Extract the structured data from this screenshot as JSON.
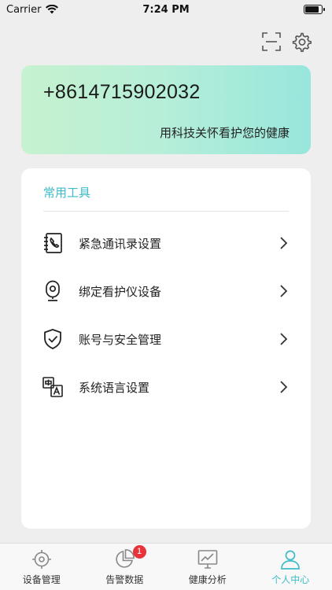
{
  "status_bar": {
    "carrier": "Carrier",
    "time": "7:24 PM",
    "battery_level": 0.85
  },
  "profile": {
    "phone": "+8614715902032",
    "slogan": "用科技关怀看护您的健康"
  },
  "tools": {
    "title": "常用工具",
    "items": [
      {
        "label": "紧急通讯录设置",
        "icon": "contact-book-icon"
      },
      {
        "label": "绑定看护仪设备",
        "icon": "camera-device-icon"
      },
      {
        "label": "账号与安全管理",
        "icon": "shield-check-icon"
      },
      {
        "label": "系统语言设置",
        "icon": "language-translate-icon"
      }
    ]
  },
  "tabs": [
    {
      "label": "设备管理",
      "icon": "target-icon"
    },
    {
      "label": "告警数据",
      "icon": "pie-chart-icon",
      "badge": "1"
    },
    {
      "label": "健康分析",
      "icon": "trend-chart-icon"
    },
    {
      "label": "个人中心",
      "icon": "user-icon",
      "active": true
    }
  ],
  "colors": {
    "accent": "#3cbcc8",
    "badge": "#e8333a",
    "background": "#eeeeee"
  }
}
